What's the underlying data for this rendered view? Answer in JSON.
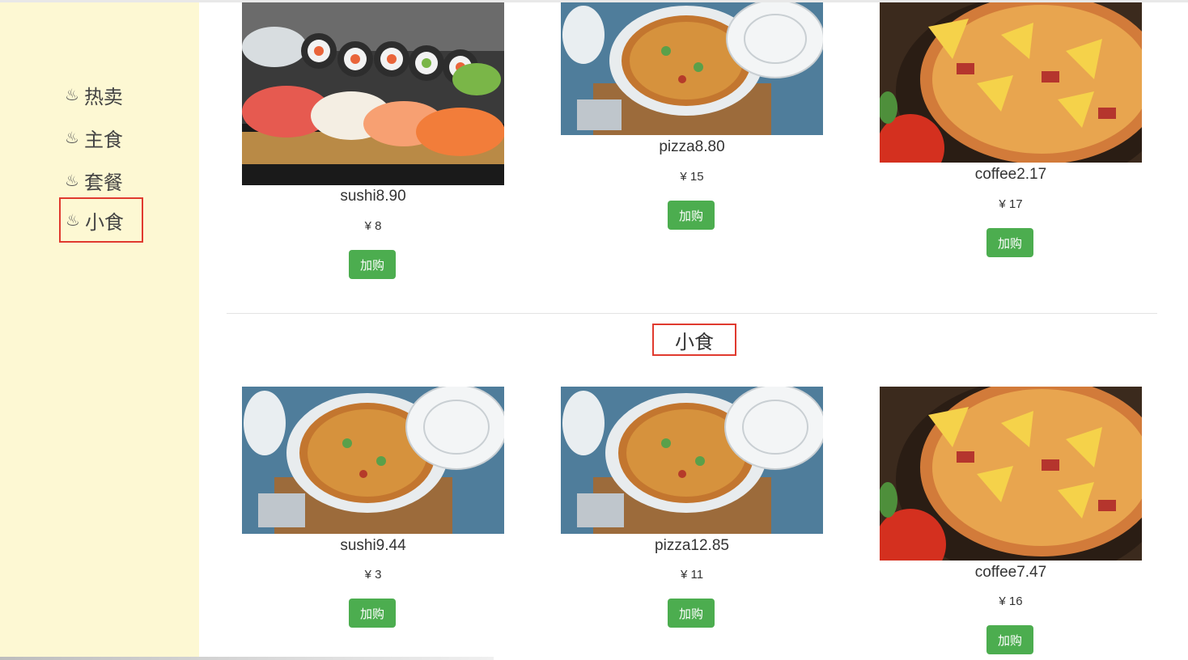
{
  "sidebar": {
    "steam_glyph": "♨",
    "items": [
      {
        "label": "热卖"
      },
      {
        "label": "主食"
      },
      {
        "label": "套餐"
      },
      {
        "label": "小食"
      }
    ]
  },
  "section": {
    "title": "小食"
  },
  "top_row": [
    {
      "name": "sushi8.90",
      "price": "¥ 8",
      "button": "加购",
      "image": "sushi-photo"
    },
    {
      "name": "pizza8.80",
      "price": "¥ 15",
      "button": "加购",
      "image": "pasta-pan-photo"
    },
    {
      "name": "coffee2.17",
      "price": "¥ 17",
      "button": "加购",
      "image": "pizza-photo"
    }
  ],
  "bottom_row": [
    {
      "name": "sushi9.44",
      "price": "¥ 3",
      "button": "加购",
      "image": "pasta-pan-photo"
    },
    {
      "name": "pizza12.85",
      "price": "¥ 11",
      "button": "加购",
      "image": "pasta-pan-photo"
    },
    {
      "name": "coffee7.47",
      "price": "¥ 16",
      "button": "加购",
      "image": "pizza-photo"
    }
  ],
  "colors": {
    "sidebar_bg": "#fdf8d3",
    "button_green": "#4cad4f",
    "highlight_red": "#e03a2f"
  }
}
